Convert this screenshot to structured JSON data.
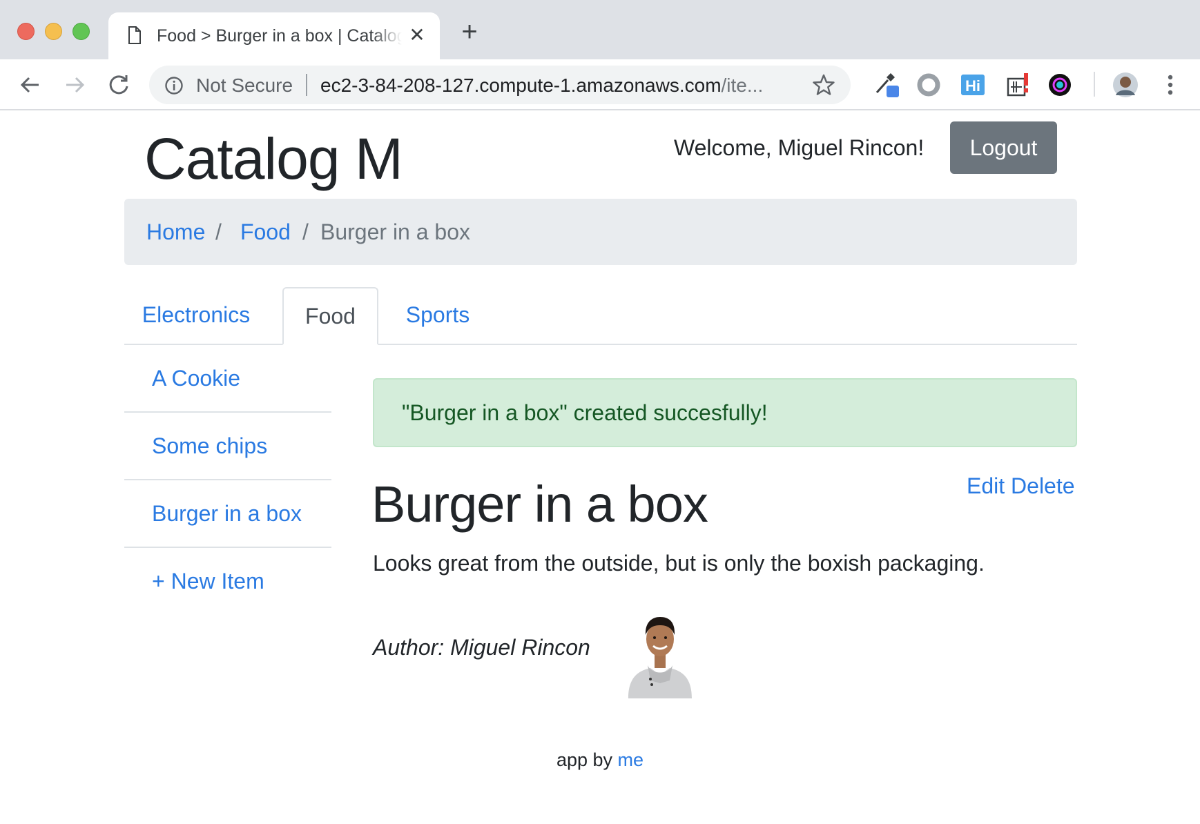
{
  "browser": {
    "tab_title": "Food > Burger in a box | Catalog M",
    "tab_close": "✕",
    "new_tab": "+",
    "security_label": "Not Secure",
    "url_main": "ec2-3-84-208-127.compute-1.amazonaws.com",
    "url_rest": "/ite..."
  },
  "header": {
    "brand": "Catalog M",
    "welcome": "Welcome, Miguel Rincon!",
    "logout_label": "Logout"
  },
  "breadcrumb": {
    "home": "Home",
    "category": "Food",
    "current": "Burger in a box",
    "separator": "/"
  },
  "category_tabs": [
    {
      "label": "Electronics",
      "active": false
    },
    {
      "label": "Food",
      "active": true
    },
    {
      "label": "Sports",
      "active": false
    }
  ],
  "sidebar": {
    "items": [
      {
        "label": "A Cookie"
      },
      {
        "label": "Some chips"
      },
      {
        "label": "Burger in a box"
      }
    ],
    "new_item": "+ New Item"
  },
  "alert": {
    "message": "\"Burger in a box\" created succesfully!"
  },
  "item": {
    "title": "Burger in a box",
    "edit_label": "Edit",
    "delete_label": "Delete",
    "description": "Looks great from the outside, but is only the boxish packaging.",
    "author": "Author: Miguel Rincon"
  },
  "footer": {
    "text": "app by ",
    "link": "me"
  },
  "colors": {
    "link": "#2a7ae2",
    "logout_bg": "#6c757d",
    "alert_bg": "#d4edda",
    "alert_text": "#155724",
    "breadcrumb_bg": "#e9ecef"
  }
}
